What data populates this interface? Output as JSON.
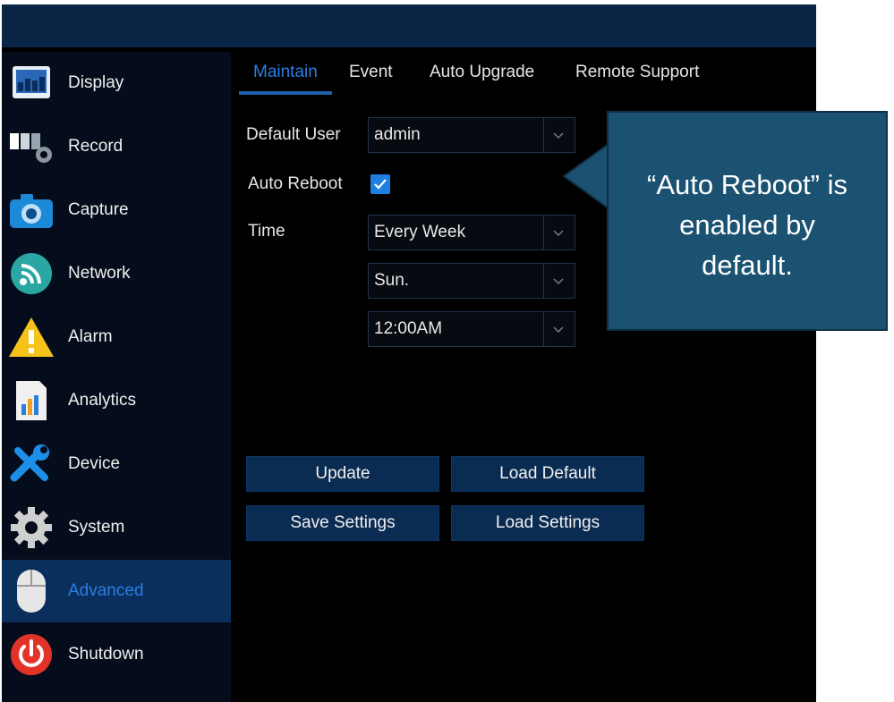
{
  "sidebar": {
    "items": [
      {
        "label": "Display",
        "icon": "display-icon"
      },
      {
        "label": "Record",
        "icon": "record-icon"
      },
      {
        "label": "Capture",
        "icon": "camera-icon"
      },
      {
        "label": "Network",
        "icon": "network-icon"
      },
      {
        "label": "Alarm",
        "icon": "alarm-icon"
      },
      {
        "label": "Analytics",
        "icon": "analytics-icon"
      },
      {
        "label": "Device",
        "icon": "wrench-icon"
      },
      {
        "label": "System",
        "icon": "gear-icon"
      },
      {
        "label": "Advanced",
        "icon": "mouse-icon",
        "active": true
      },
      {
        "label": "Shutdown",
        "icon": "power-icon"
      }
    ]
  },
  "tabs": [
    {
      "label": "Maintain",
      "active": true
    },
    {
      "label": "Event"
    },
    {
      "label": "Auto Upgrade"
    },
    {
      "label": "Remote Support"
    }
  ],
  "form": {
    "default_user_label": "Default User",
    "default_user_value": "admin",
    "auto_reboot_label": "Auto Reboot",
    "auto_reboot_checked": true,
    "time_label": "Time",
    "time_frequency": "Every Week",
    "time_day": "Sun.",
    "time_clock": "12:00AM"
  },
  "buttons": {
    "update": "Update",
    "load_default": "Load Default",
    "save_settings": "Save Settings",
    "load_settings": "Load Settings"
  },
  "callout": {
    "line1": "“Auto Reboot” is",
    "line2": "enabled by",
    "line3": "default."
  },
  "colors": {
    "accent": "#2a7ee0",
    "callout_bg": "#1b5271",
    "topbar": "#0a2546",
    "active_nav": "#0b2f5c"
  }
}
